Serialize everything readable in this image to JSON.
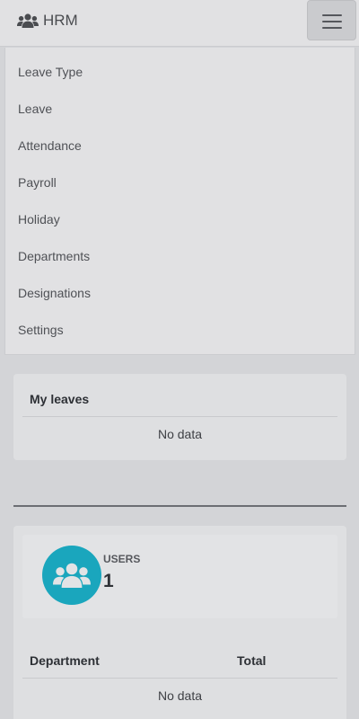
{
  "navbar": {
    "brand": "HRM",
    "brand_icon": "users-icon",
    "toggle_icon": "hamburger-menu-icon"
  },
  "menu": {
    "items": [
      {
        "label": "Leave Type"
      },
      {
        "label": "Leave"
      },
      {
        "label": "Attendance"
      },
      {
        "label": "Payroll"
      },
      {
        "label": "Holiday"
      },
      {
        "label": "Departments"
      },
      {
        "label": "Designations"
      },
      {
        "label": "Settings"
      }
    ]
  },
  "my_leaves": {
    "title": "My leaves",
    "empty_text": "No data"
  },
  "users_stat": {
    "icon": "users-icon",
    "label": "USERS",
    "value": "1",
    "accent_color": "#1aa6bd"
  },
  "department_table": {
    "columns": [
      "Department",
      "Total"
    ],
    "empty_text": "No data"
  }
}
